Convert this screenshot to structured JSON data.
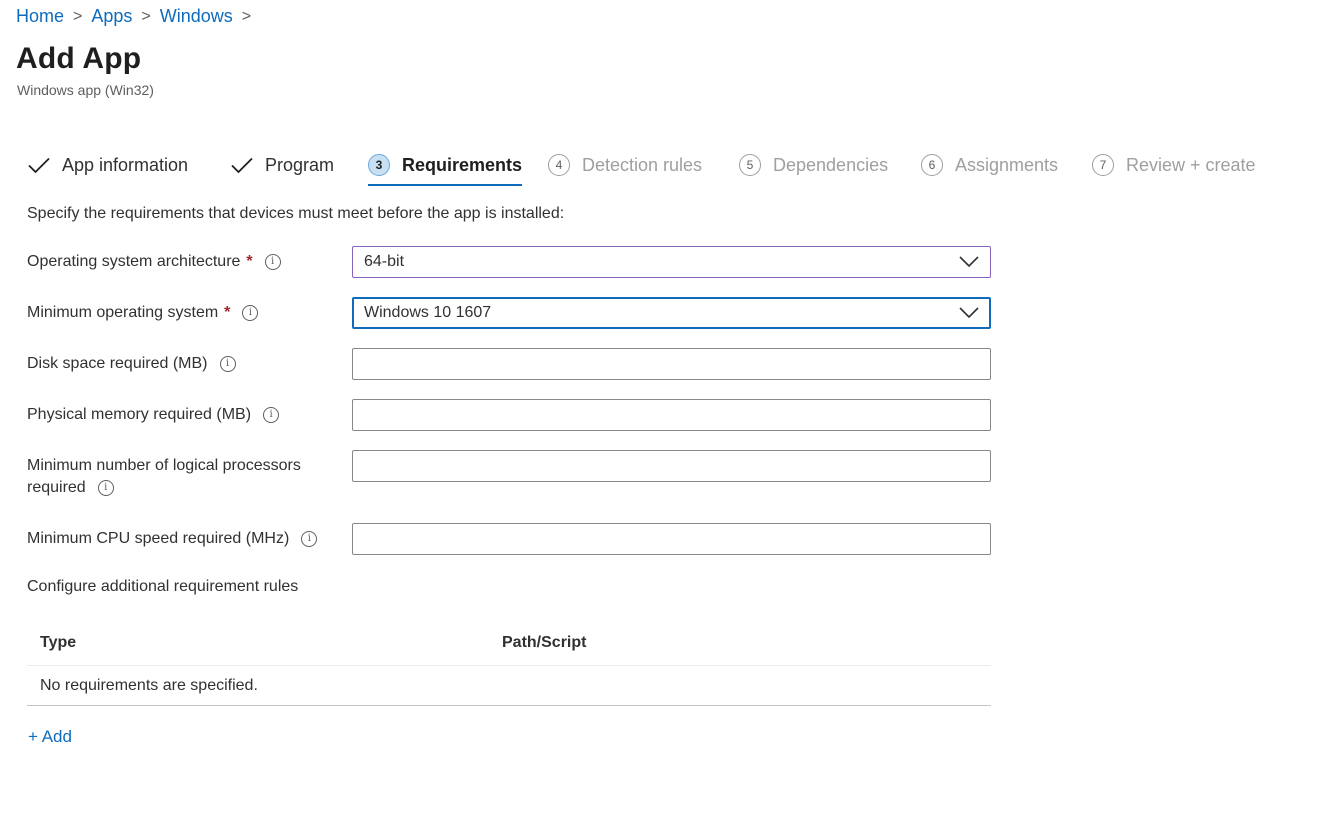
{
  "breadcrumb": {
    "items": [
      "Home",
      "Apps",
      "Windows"
    ],
    "separator": ">"
  },
  "header": {
    "title": "Add App",
    "subtitle": "Windows app (Win32)"
  },
  "wizard": {
    "steps": [
      {
        "label": "App information",
        "status": "done",
        "icon": "checkmark-icon"
      },
      {
        "label": "Program",
        "status": "done",
        "icon": "checkmark-icon"
      },
      {
        "number": "3",
        "label": "Requirements",
        "status": "current"
      },
      {
        "number": "4",
        "label": "Detection rules",
        "status": "pending"
      },
      {
        "number": "5",
        "label": "Dependencies",
        "status": "pending"
      },
      {
        "number": "6",
        "label": "Assignments",
        "status": "pending"
      },
      {
        "number": "7",
        "label": "Review + create",
        "status": "pending"
      }
    ]
  },
  "form": {
    "intro": "Specify the requirements that devices must meet before the app is installed:",
    "required_mark": "*",
    "info_glyph": "i",
    "fields": {
      "os_architecture": {
        "label": "Operating system architecture",
        "value": "64-bit",
        "required": true
      },
      "min_os": {
        "label": "Minimum operating system",
        "value": "Windows 10 1607",
        "required": true
      },
      "disk_space": {
        "label": "Disk space required (MB)",
        "value": ""
      },
      "physical_memory": {
        "label": "Physical memory required (MB)",
        "value": ""
      },
      "logical_processors": {
        "label_line1": "Minimum number of logical processors",
        "label_line2": "required",
        "value": ""
      },
      "cpu_speed": {
        "label": "Minimum CPU speed required (MHz)",
        "value": ""
      }
    }
  },
  "requirement_rules": {
    "title": "Configure additional requirement rules",
    "columns": [
      "Type",
      "Path/Script"
    ],
    "empty_message": "No requirements are specified.",
    "add_label": "+ Add"
  },
  "colors": {
    "accent": "#0f6cbd",
    "required": "#a4262c",
    "focus_purple": "#8764b8"
  }
}
